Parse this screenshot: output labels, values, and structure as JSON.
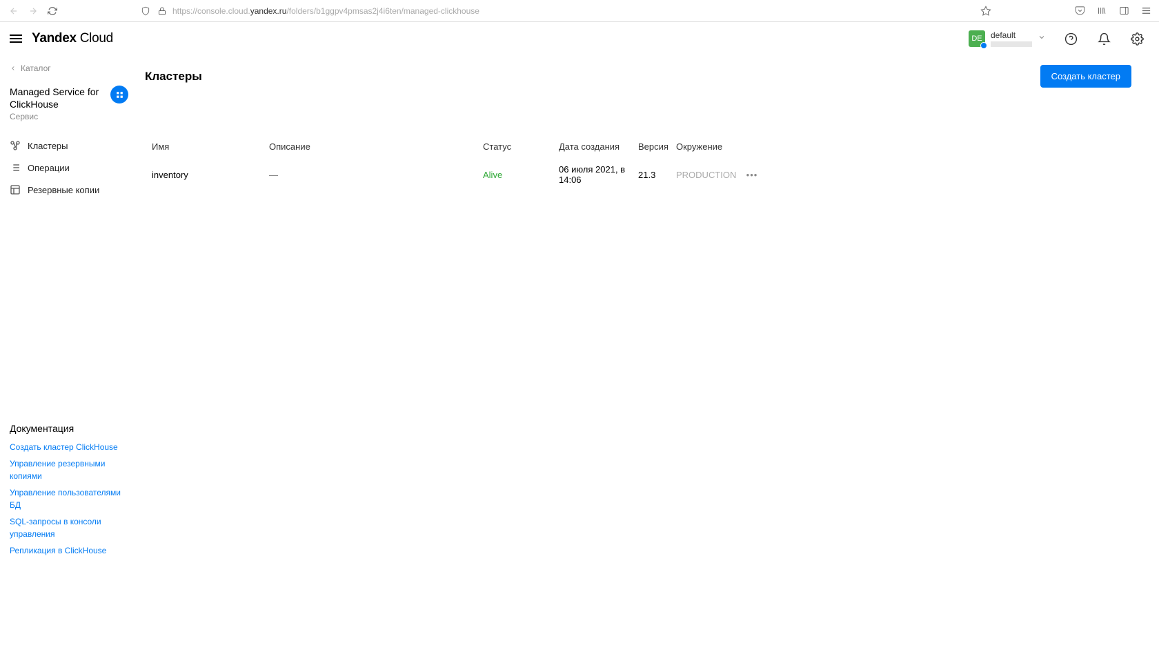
{
  "browser": {
    "url_prefix": "https://console.cloud.",
    "url_domain": "yandex.ru",
    "url_suffix": "/folders/b1ggpv4pmsas2j4i6ten/managed-clickhouse"
  },
  "header": {
    "brand_bold": "Yandex",
    "brand_light": "Cloud",
    "avatar_initials": "DE",
    "user_name": "default"
  },
  "sidebar": {
    "breadcrumb": "Каталог",
    "service_name": "Managed Service for ClickHouse",
    "service_sub": "Сервис",
    "nav": [
      {
        "label": "Кластеры",
        "icon": "clusters"
      },
      {
        "label": "Операции",
        "icon": "operations"
      },
      {
        "label": "Резервные копии",
        "icon": "backups"
      }
    ],
    "doc_title": "Документация",
    "doc_links": [
      "Создать кластер ClickHouse",
      "Управление резервными копиями",
      "Управление пользователями БД",
      "SQL-запросы в консоли управления",
      "Репликация в ClickHouse"
    ]
  },
  "main": {
    "title": "Кластеры",
    "create_btn": "Создать кластер",
    "columns": {
      "name": "Имя",
      "desc": "Описание",
      "status": "Статус",
      "date": "Дата создания",
      "version": "Версия",
      "env": "Окружение"
    },
    "rows": [
      {
        "name": "inventory",
        "desc": "—",
        "status": "Alive",
        "date": "06 июля 2021, в 14:06",
        "version": "21.3",
        "env": "PRODUCTION"
      }
    ]
  }
}
